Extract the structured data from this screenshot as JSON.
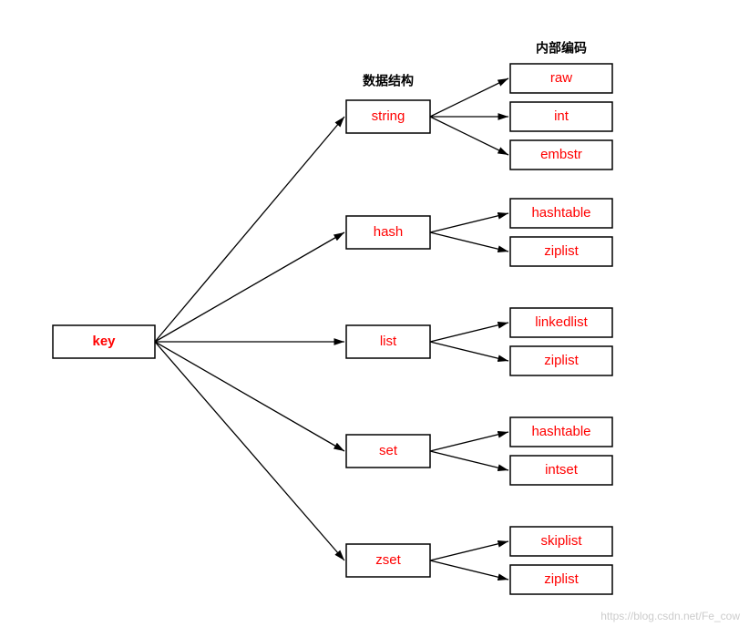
{
  "headers": {
    "data_struct": "数据结构",
    "encoding": "内部编码"
  },
  "root": "key",
  "types": [
    {
      "name": "string",
      "encodings": [
        "raw",
        "int",
        "embstr"
      ]
    },
    {
      "name": "hash",
      "encodings": [
        "hashtable",
        "ziplist"
      ]
    },
    {
      "name": "list",
      "encodings": [
        "linkedlist",
        "ziplist"
      ]
    },
    {
      "name": "set",
      "encodings": [
        "hashtable",
        "intset"
      ]
    },
    {
      "name": "zset",
      "encodings": [
        "skiplist",
        "ziplist"
      ]
    }
  ],
  "watermark": "https://blog.csdn.net/Fe_cow"
}
